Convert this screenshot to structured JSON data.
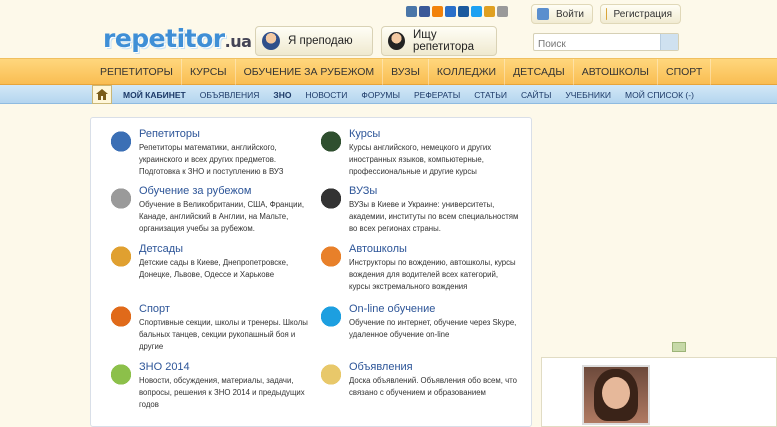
{
  "logo": {
    "main": "repetitor",
    "domain": ".ua"
  },
  "header": {
    "teach_button": "Я преподаю",
    "find_button": "Ищу репетитора",
    "login": "Войти",
    "register": "Регистрация",
    "search_placeholder": "Поиск"
  },
  "social_icons": [
    "vk-icon",
    "facebook-icon",
    "odnoklassniki-icon",
    "mail-icon",
    "moimir-icon",
    "twitter-icon",
    "livejournal-icon",
    "google-icon"
  ],
  "nav_main": [
    "РЕПЕТИТОРЫ",
    "КУРСЫ",
    "ОБУЧЕНИЕ ЗА РУБЕЖОМ",
    "ВУЗЫ",
    "КОЛЛЕДЖИ",
    "ДЕТСАДЫ",
    "АВТОШКОЛЫ",
    "СПОРТ"
  ],
  "nav_sub": [
    "МОЙ КАБИНЕТ",
    "ОБЪЯВЛЕНИЯ",
    "ЗНО",
    "НОВОСТИ",
    "ФОРУМЫ",
    "РЕФЕРАТЫ",
    "СТАТЬИ",
    "САЙТЫ",
    "УЧЕБНИКИ",
    "МОЙ СПИСОК (-)"
  ],
  "categories": [
    {
      "title": "Репетиторы",
      "text": "Репетиторы математики, английского, украинского и всех других предметов. Подготовка к ЗНО и поступлению в ВУЗ",
      "icon": "tutor-icon",
      "color": "#3b6fb5"
    },
    {
      "title": "Курсы",
      "text": "Курсы английского, немецкого и других иностранных языков, компьютерные, профессиональные и другие курсы",
      "icon": "blackboard-icon",
      "color": "#2f4f2f"
    },
    {
      "title": "Обучение за рубежом",
      "text": "Обучение в Великобритании, США, Франции, Канаде, английский в Англии, на Мальте, организация учебы за рубежом.",
      "icon": "building-icon",
      "color": "#9a9a9a"
    },
    {
      "title": "ВУЗы",
      "text": "ВУЗы в Киеве и Украине: университеты, академии, институты по всем специальностям во всех регионах страны.",
      "icon": "graduation-cap-icon",
      "color": "#333333"
    },
    {
      "title": "Детсады",
      "text": "Детские сады в Киеве, Днепропетровске, Донецке, Львове, Одессе и Харькове",
      "icon": "teddy-bear-icon",
      "color": "#e0a030"
    },
    {
      "title": "Автошколы",
      "text": "Инструкторы по вождению, автошколы, курсы вождения для водителей всех категорий, курсы экстремального вождения",
      "icon": "car-icon",
      "color": "#e8802a"
    },
    {
      "title": "Спорт",
      "text": "Спортивные секции, школы и тренеры. Школы бальных танцев, секции рукопашный боя и другие",
      "icon": "basketball-icon",
      "color": "#e06a1a"
    },
    {
      "title": "On-line обучение",
      "text": "Обучение по интернет, обучение через Skype, удаленное обучение on-line",
      "icon": "skype-icon",
      "color": "#1d9fe0"
    },
    {
      "title": "ЗНО 2014",
      "text": "Новости, обсуждения, материалы, задачи, вопросы, решения к ЗНО 2014 и предыдущих годов",
      "icon": "chart-icon",
      "color": "#8cc04a"
    },
    {
      "title": "Объявления",
      "text": "Доска объявлений. Объявления обо всем, что связано с обучением и образованием",
      "icon": "notepad-icon",
      "color": "#e8c86a"
    }
  ],
  "colors": {
    "nav_main": "#f9bd52",
    "nav_sub": "#b4d5ef",
    "link": "#2d5598",
    "background": "#fdf9ea"
  }
}
